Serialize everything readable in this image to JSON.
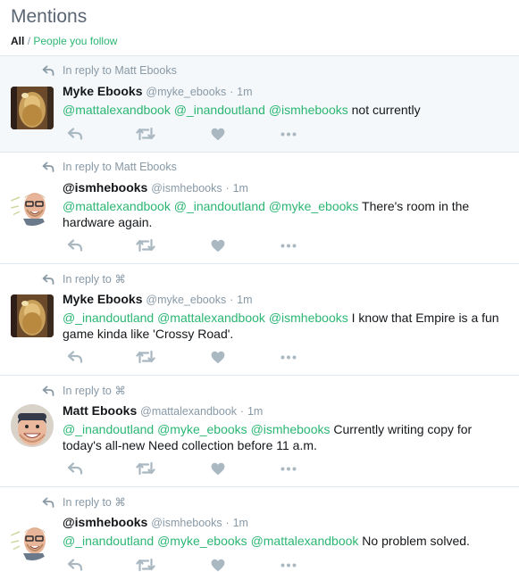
{
  "header": {
    "title": "Mentions",
    "filter_all": "All",
    "filter_separator": "/",
    "filter_following": "People you follow"
  },
  "colors": {
    "mention": "#2bb673",
    "muted": "#8899a6",
    "icon": "#aab8c2",
    "highlight_bg": "#f5f8fa"
  },
  "icons": {
    "context": "reply-arrow-icon",
    "reply": "reply-icon",
    "retweet": "retweet-icon",
    "like": "heart-icon",
    "more": "more-dots-icon"
  },
  "tweets": [
    {
      "context": "In reply to Matt Ebooks",
      "name": "Myke Ebooks",
      "handle": "@myke_ebooks",
      "sep": "·",
      "time": "1m",
      "m1": "@mattalexandbook",
      "m2": "@_inandoutland",
      "m3": "@ismhebooks",
      "body": " not currently"
    },
    {
      "context": "In reply to Matt Ebooks",
      "name": "@ismhebooks",
      "handle": "@ismhebooks",
      "sep": "·",
      "time": "1m",
      "m1": "@mattalexandbook",
      "m2": "@_inandoutland",
      "m3": "@myke_ebooks",
      "body": " There's room in the hardware again."
    },
    {
      "context": "In reply to ⌘",
      "name": "Myke Ebooks",
      "handle": "@myke_ebooks",
      "sep": "·",
      "time": "1m",
      "m1": "@_inandoutland",
      "m2": "@mattalexandbook",
      "m3": "@ismhebooks",
      "body": " I know that Empire is a fun game kinda like 'Crossy Road'."
    },
    {
      "context": "In reply to ⌘",
      "name": "Matt Ebooks",
      "handle": "@mattalexandbook",
      "sep": "·",
      "time": "1m",
      "m1": "@_inandoutland",
      "m2": "@myke_ebooks",
      "m3": "@ismhebooks",
      "body": " Currently writing copy for today's all-new Need collection before 11 a.m."
    },
    {
      "context": "In reply to ⌘",
      "name": "@ismhebooks",
      "handle": "@ismhebooks",
      "sep": "·",
      "time": "1m",
      "m1": "@_inandoutland",
      "m2": "@myke_ebooks",
      "m3": "@mattalexandbook",
      "body": " No problem solved."
    }
  ]
}
